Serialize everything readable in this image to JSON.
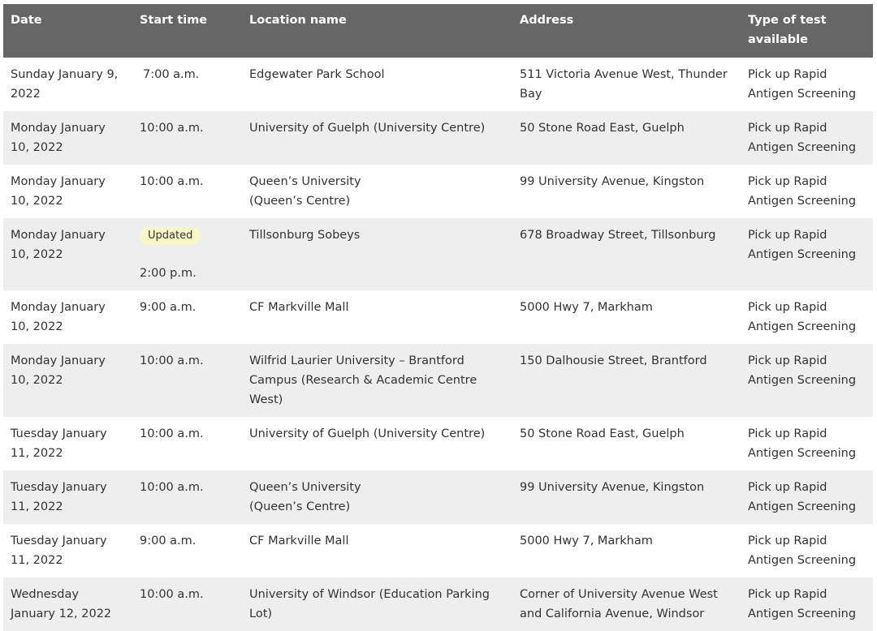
{
  "headers": {
    "date": "Date",
    "start_time": "Start time",
    "location": "Location name",
    "address": "Address",
    "type": "Type of test available"
  },
  "rows": [
    {
      "date": "Sunday January 9, 2022",
      "start_time": "7:00 a.m.",
      "location": "Edgewater Park School",
      "address": "511 Victoria Avenue West, Thunder Bay",
      "type": "Pick up Rapid Antigen Screening"
    },
    {
      "date": "Monday January 10, 2022",
      "start_time": "10:00 a.m.",
      "location": "University of Guelph (University Centre)",
      "address": "50 Stone Road East, Guelph",
      "type": "Pick up Rapid Antigen Screening"
    },
    {
      "date": "Monday January 10, 2022",
      "start_time": "10:00 a.m.",
      "location_line1": "Queen’s University",
      "location_line2": "(Queen’s Centre)",
      "address": "99 University Avenue, Kingston",
      "type": "Pick up Rapid Antigen Screening"
    },
    {
      "date": "Monday January 10, 2022",
      "badge": "Updated",
      "start_time": "2:00 p.m.",
      "location": "Tillsonburg Sobeys",
      "address": "678 Broadway Street, Tillsonburg",
      "type": "Pick up Rapid Antigen Screening"
    },
    {
      "date": "Monday January 10, 2022",
      "start_time": "9:00 a.m.",
      "location": "CF Markville Mall",
      "address": "5000 Hwy 7, Markham",
      "type": "Pick up Rapid Antigen Screening"
    },
    {
      "date": "Monday January 10, 2022",
      "start_time": "10:00 a.m.",
      "location": "Wilfrid Laurier University – Brantford Campus (Research & Academic Centre West)",
      "address": "150 Dalhousie Street, Brantford",
      "type": "Pick up Rapid Antigen Screening"
    },
    {
      "date": "Tuesday January 11, 2022",
      "start_time": "10:00 a.m.",
      "location": "University of Guelph (University Centre)",
      "address": "50 Stone Road East, Guelph",
      "type": "Pick up Rapid Antigen Screening"
    },
    {
      "date": "Tuesday January 11, 2022",
      "start_time": "10:00 a.m.",
      "location_line1": "Queen’s University",
      "location_line2": "(Queen’s Centre)",
      "address": "99 University Avenue, Kingston",
      "type": "Pick up Rapid Antigen Screening"
    },
    {
      "date": "Tuesday January 11, 2022",
      "start_time": "9:00 a.m.",
      "location": "CF Markville Mall",
      "address": "5000 Hwy 7, Markham",
      "type": "Pick up Rapid Antigen Screening"
    },
    {
      "date": "Wednesday January 12, 2022",
      "start_time": "10:00 a.m.",
      "location": "University of Windsor (Education Parking Lot)",
      "address": "Corner of University Avenue West and California Avenue, Windsor",
      "type": "Pick up Rapid Antigen Screening"
    }
  ],
  "colors": {
    "header_bg": "#666666",
    "header_text": "#ffffff",
    "row_alt_bg": "#eeeeee",
    "badge_bg": "#f8f8c6"
  }
}
